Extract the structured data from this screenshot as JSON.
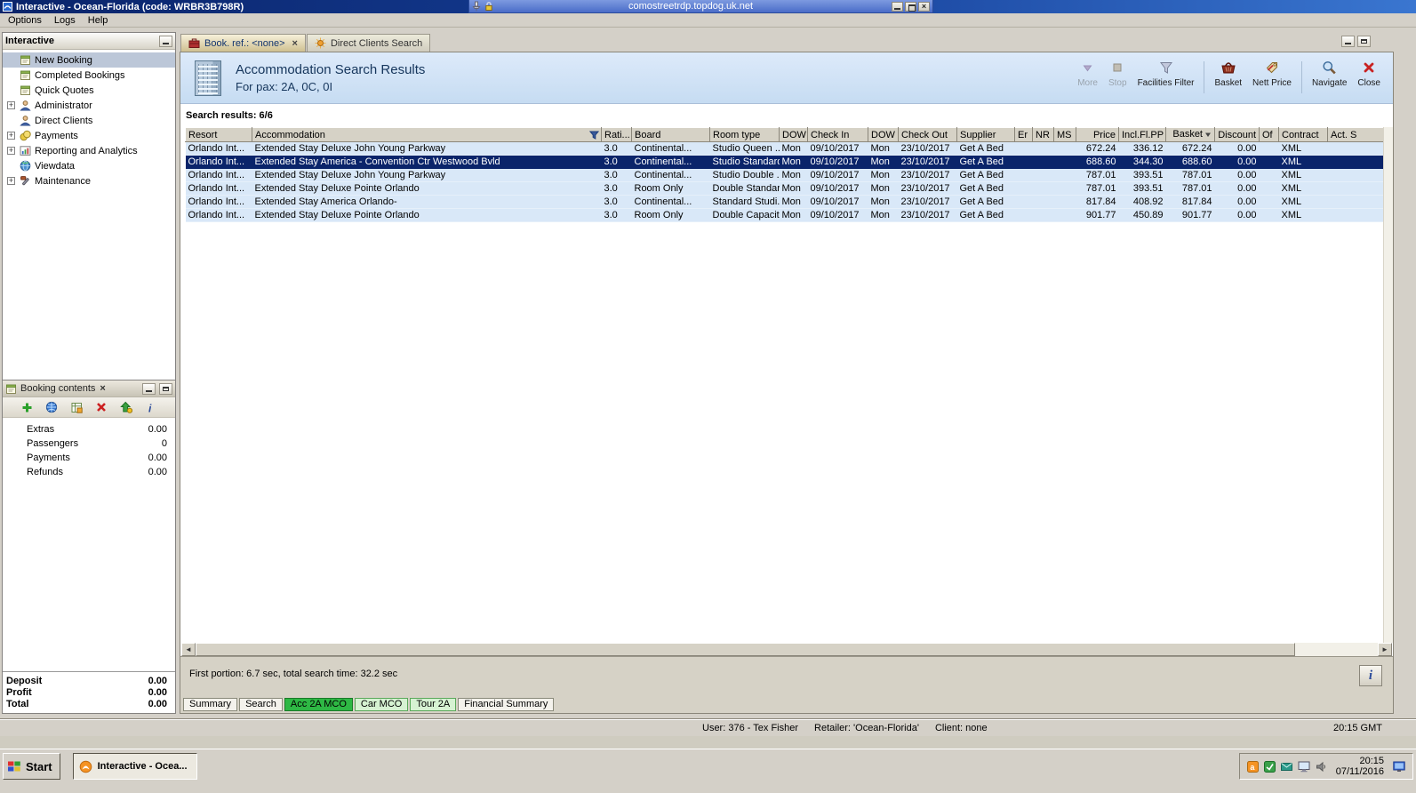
{
  "window": {
    "title": "Interactive - Ocean-Florida (code: WRBR3B798R)"
  },
  "rdp": {
    "host": "comostreetrdp.topdog.uk.net"
  },
  "menu": {
    "items": [
      "Options",
      "Logs",
      "Help"
    ]
  },
  "sidebar": {
    "title": "Interactive",
    "items": [
      {
        "label": "New Booking",
        "icon": "doc",
        "expandable": false,
        "selected": true
      },
      {
        "label": "Completed Bookings",
        "icon": "doc",
        "expandable": false,
        "selected": false
      },
      {
        "label": "Quick Quotes",
        "icon": "doc",
        "expandable": false,
        "selected": false
      },
      {
        "label": "Administrator",
        "icon": "person",
        "expandable": true,
        "selected": false
      },
      {
        "label": "Direct Clients",
        "icon": "person",
        "expandable": false,
        "selected": false
      },
      {
        "label": "Payments",
        "icon": "coins",
        "expandable": true,
        "selected": false
      },
      {
        "label": "Reporting and Analytics",
        "icon": "report",
        "expandable": true,
        "selected": false
      },
      {
        "label": "Viewdata",
        "icon": "globe",
        "expandable": false,
        "selected": false
      },
      {
        "label": "Maintenance",
        "icon": "tools",
        "expandable": true,
        "selected": false
      }
    ]
  },
  "booking_panel": {
    "title": "Booking contents",
    "toolbar": [
      {
        "icon": "add",
        "name": "add-item-button"
      },
      {
        "icon": "world",
        "name": "availability-button"
      },
      {
        "icon": "views",
        "name": "views-button"
      },
      {
        "icon": "del",
        "name": "delete-item-button"
      },
      {
        "icon": "promote",
        "name": "promote-item-button"
      },
      {
        "icon": "info",
        "name": "info-button"
      }
    ],
    "rows": [
      {
        "label": "Extras",
        "value": "0.00"
      },
      {
        "label": "Passengers",
        "value": "0"
      },
      {
        "label": "Payments",
        "value": "0.00"
      },
      {
        "label": "Refunds",
        "value": "0.00"
      }
    ],
    "totals": [
      {
        "label": "Deposit",
        "value": "0.00"
      },
      {
        "label": "Profit",
        "value": "0.00"
      },
      {
        "label": "Total",
        "value": "0.00"
      }
    ]
  },
  "editor_tabs": [
    {
      "label": "Book. ref.: <none>",
      "icon": "bookref",
      "active": true,
      "closable": true
    },
    {
      "label": "Direct Clients Search",
      "icon": "clientsearch",
      "active": false,
      "closable": false
    }
  ],
  "header": {
    "title": "Accommodation Search Results",
    "subtitle": "For pax: 2A, 0C, 0I",
    "tools": [
      {
        "label": "More",
        "icon": "more",
        "disabled": true
      },
      {
        "label": "Stop",
        "icon": "stop",
        "disabled": true
      },
      {
        "label": "Facilities Filter",
        "icon": "filter",
        "disabled": false
      },
      {
        "sep": true
      },
      {
        "label": "Basket",
        "icon": "basket",
        "disabled": false
      },
      {
        "label": "Nett Price",
        "icon": "nett",
        "disabled": false
      },
      {
        "sep": true
      },
      {
        "label": "Navigate",
        "icon": "navigate",
        "disabled": false
      },
      {
        "label": "Close",
        "icon": "close",
        "disabled": false
      }
    ]
  },
  "results": {
    "label": "Search results: 6/6",
    "columns": [
      "Resort",
      "Accommodation",
      "Rati...",
      "Board",
      "Room type",
      "DOW",
      "Check In",
      "DOW",
      "Check Out",
      "Supplier",
      "Er",
      "NR",
      "MS",
      "Price",
      "Incl.Fl.PP",
      "Basket",
      "Discount",
      "Of",
      "Contract",
      "Act. S"
    ],
    "selected_index": 1,
    "rows": [
      [
        "Orlando Int...",
        "Extended Stay Deluxe John Young Parkway",
        "3.0",
        "Continental...",
        "Studio Queen ...",
        "Mon",
        "09/10/2017",
        "Mon",
        "23/10/2017",
        "Get A Bed",
        "",
        "",
        "",
        "672.24",
        "336.12",
        "672.24",
        "0.00",
        "",
        "XML",
        ""
      ],
      [
        "Orlando Int...",
        "Extended Stay America - Convention Ctr Westwood Bvld",
        "3.0",
        "Continental...",
        "Studio Standard",
        "Mon",
        "09/10/2017",
        "Mon",
        "23/10/2017",
        "Get A Bed",
        "",
        "",
        "",
        "688.60",
        "344.30",
        "688.60",
        "0.00",
        "",
        "XML",
        ""
      ],
      [
        "Orlando Int...",
        "Extended Stay Deluxe John Young Parkway",
        "3.0",
        "Continental...",
        "Studio Double ...",
        "Mon",
        "09/10/2017",
        "Mon",
        "23/10/2017",
        "Get A Bed",
        "",
        "",
        "",
        "787.01",
        "393.51",
        "787.01",
        "0.00",
        "",
        "XML",
        ""
      ],
      [
        "Orlando Int...",
        "Extended Stay Deluxe Pointe Orlando",
        "3.0",
        "Room Only",
        "Double Standard",
        "Mon",
        "09/10/2017",
        "Mon",
        "23/10/2017",
        "Get A Bed",
        "",
        "",
        "",
        "787.01",
        "393.51",
        "787.01",
        "0.00",
        "",
        "XML",
        ""
      ],
      [
        "Orlando Int...",
        "Extended Stay America Orlando-",
        "3.0",
        "Continental...",
        "Standard Studi...",
        "Mon",
        "09/10/2017",
        "Mon",
        "23/10/2017",
        "Get A Bed",
        "",
        "",
        "",
        "817.84",
        "408.92",
        "817.84",
        "0.00",
        "",
        "XML",
        ""
      ],
      [
        "Orlando Int...",
        "Extended Stay Deluxe Pointe Orlando",
        "3.0",
        "Room Only",
        "Double Capacit...",
        "Mon",
        "09/10/2017",
        "Mon",
        "23/10/2017",
        "Get A Bed",
        "",
        "",
        "",
        "901.77",
        "450.89",
        "901.77",
        "0.00",
        "",
        "XML",
        ""
      ]
    ]
  },
  "status_line": {
    "text": "First portion: 6.7 sec, total search time: 32.2 sec"
  },
  "bottom_tabs": [
    {
      "label": "Summary",
      "style": "plain"
    },
    {
      "label": "Search",
      "style": "plain"
    },
    {
      "label": "Acc 2A MCO",
      "style": "green"
    },
    {
      "label": "Car MCO",
      "style": "lightgreen"
    },
    {
      "label": "Tour 2A",
      "style": "lightgreen"
    },
    {
      "label": "Financial Summary",
      "style": "plain"
    }
  ],
  "statusbar": {
    "user": "User: 376 - Tex Fisher",
    "retailer": "Retailer: 'Ocean-Florida'",
    "client": "Client: none",
    "time": "20:15 GMT"
  },
  "taskbar": {
    "start_label": "Start",
    "task_label": "Interactive - Ocea...",
    "clock_time": "20:15",
    "clock_date": "07/11/2016"
  },
  "tray_icons": [
    {
      "icon": "trayOrange",
      "name": "tray-app1-icon"
    },
    {
      "icon": "trayGreen",
      "name": "tray-app2-icon"
    },
    {
      "icon": "trayTeal",
      "name": "tray-mail-icon"
    },
    {
      "icon": "trayDisplay",
      "name": "tray-display-icon"
    },
    {
      "icon": "trayVolume",
      "name": "tray-volume-icon"
    }
  ],
  "colors": {
    "selection_navy": "#0a246a",
    "row_blue": "#d9e8f8",
    "accent_green": "#2eb844",
    "header_blue": "#16365c",
    "titlebar_blue": "#0a246a"
  }
}
